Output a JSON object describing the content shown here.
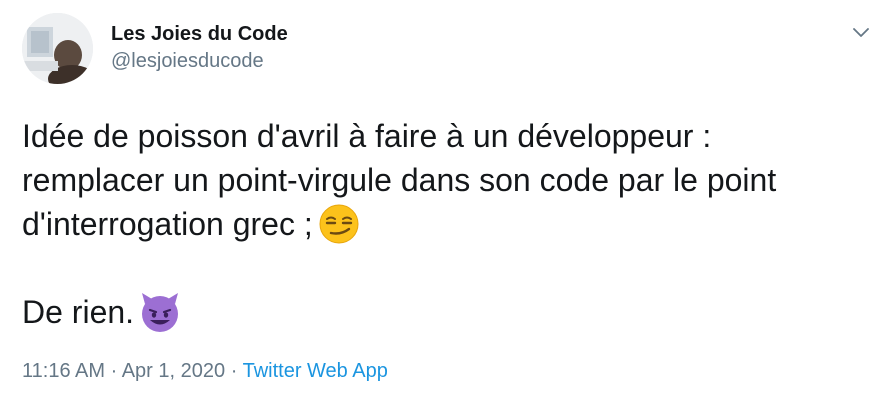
{
  "author": {
    "display_name": "Les Joies du Code",
    "handle": "@lesjoiesducode"
  },
  "tweet": {
    "text_line1": "Idée de poisson d'avril à faire à un développeur :",
    "text_line2": "remplacer un point-virgule dans son code par le point",
    "text_line3": "d'interrogation grec ;",
    "signoff": "De rien.",
    "emoji_1": "smirking-face-emoji",
    "emoji_2": "smiling-face-with-horns-emoji"
  },
  "meta": {
    "time": "11:16 AM",
    "date": "Apr 1, 2020",
    "separator": "·",
    "source": "Twitter Web App"
  },
  "colors": {
    "text": "#14171a",
    "secondary": "#657786",
    "link": "#1b95e0"
  }
}
